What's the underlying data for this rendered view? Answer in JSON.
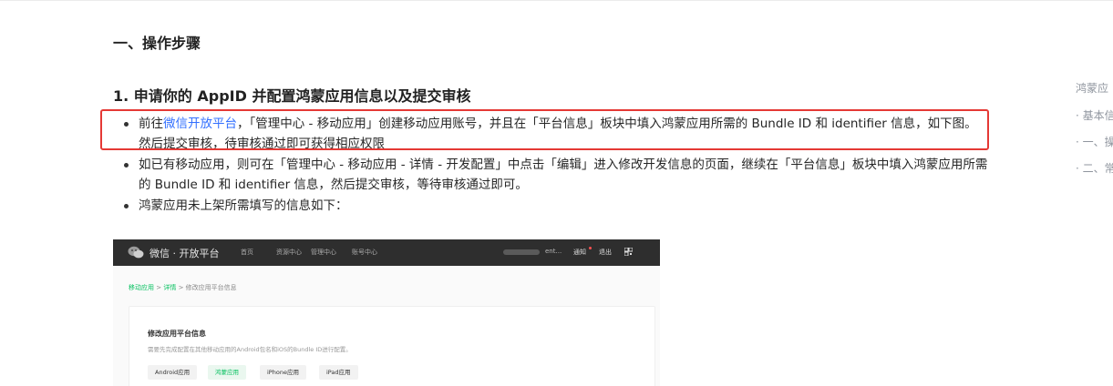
{
  "doc": {
    "section_title": "一、操作步骤",
    "step_title": "1. 申请你的 AppID 并配置鸿蒙应用信息以及提交审核",
    "items": [
      {
        "before_link": "前往",
        "link": "微信开放平台",
        "after_link": "，「管理中心 - 移动应用」创建移动应用账号，并且在「平台信息」板块中填入鸿蒙应用所需的 Bundle ID 和 identifier 信息，如下图。然后提交审核，待审核通过即可获得相应权限"
      },
      {
        "text": "如已有移动应用，则可在「管理中心 - 移动应用 - 详情 - 开发配置」中点击「编辑」进入修改开发信息的页面，继续在「平台信息」板块中填入鸿蒙应用所需的 Bundle ID 和 identifier 信息，然后提交审核，等待审核通过即可。"
      },
      {
        "text": "鸿蒙应用未上架所需填写的信息如下："
      }
    ]
  },
  "screenshot": {
    "brand": "微信 · 开放平台",
    "menu": [
      "首页",
      "资源中心",
      "管理中心",
      "账号中心"
    ],
    "user_suffix": "ent...",
    "notice": "通知",
    "exit": "退出",
    "breadcrumb": [
      "移动应用",
      "详情",
      "修改应用平台信息"
    ],
    "card_title": "修改应用平台信息",
    "card_desc": "需要先完成配置在其他移动应用的Android包名和iOS的Bundle ID进行配置。",
    "tabs": [
      "Android应用",
      "鸿蒙应用",
      "iPhone应用",
      "iPad应用"
    ],
    "active_tab": "鸿蒙应用"
  },
  "toc": [
    "鸿蒙应",
    "· 基本信",
    "· 一、操",
    "· 二、常"
  ],
  "colors": {
    "link": "#3370ff",
    "highlight_border": "#e53935",
    "wechat_green": "#07c160",
    "nav_bg": "#2e2e2e"
  },
  "icons": [
    "wechat-logo-icon",
    "qr-code-icon"
  ]
}
